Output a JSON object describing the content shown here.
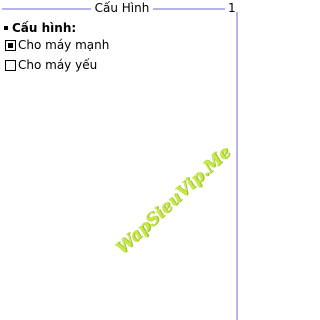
{
  "header": {
    "title": "Cấu Hình",
    "page_number": "1"
  },
  "settings": {
    "section_label": "Cấu hình:",
    "options": [
      {
        "label": "Cho máy mạnh",
        "checked": true
      },
      {
        "label": "Cho máy yếu",
        "checked": false
      }
    ]
  },
  "watermark": {
    "text": "WapSieuVip.Me"
  },
  "colors": {
    "accent_line": "#b4b4ea",
    "watermark": "#c6e84a"
  }
}
